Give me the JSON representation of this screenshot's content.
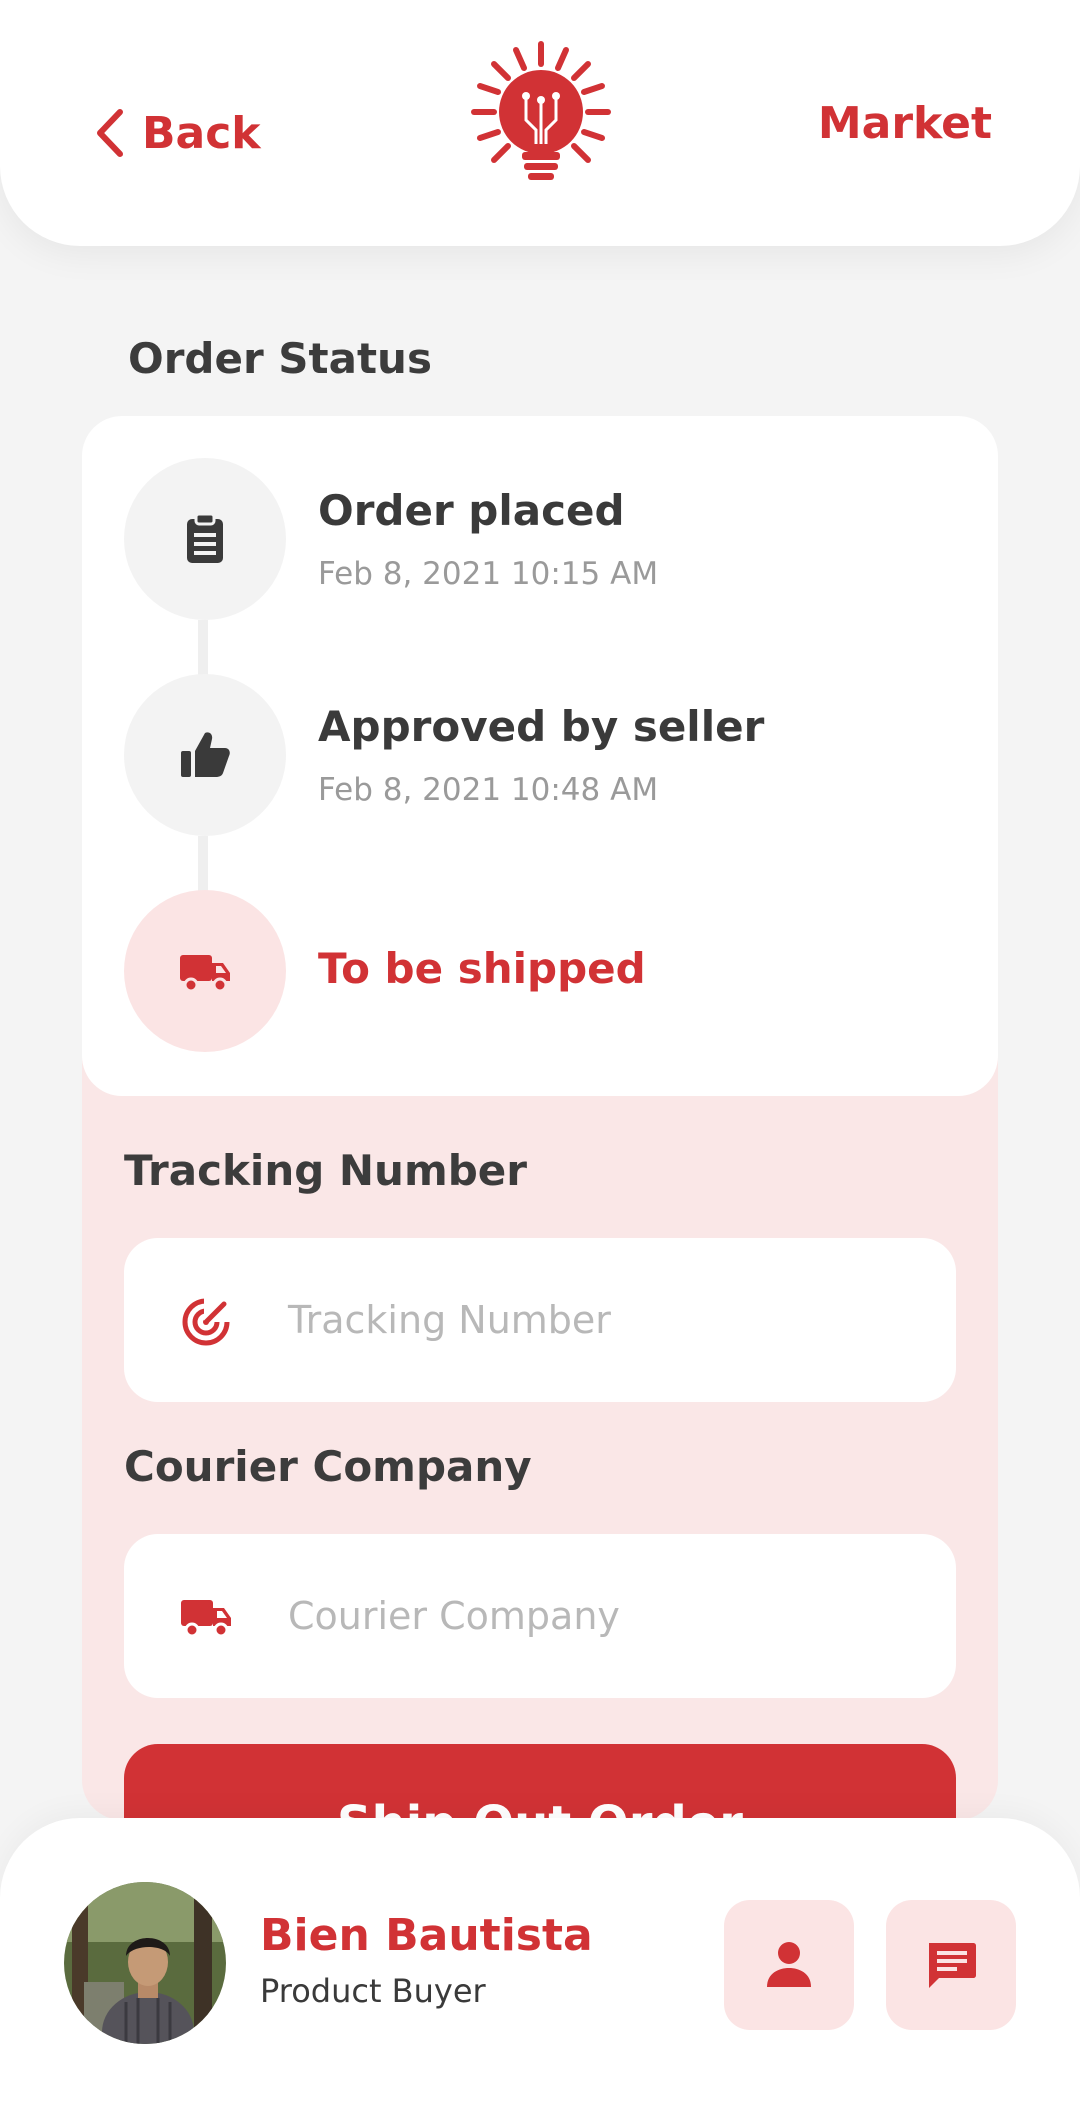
{
  "header": {
    "back_label": "Back",
    "market_label": "Market",
    "logo_icon": "sun-lightbulb-logo"
  },
  "order_status": {
    "title": "Order Status",
    "steps": [
      {
        "title": "Order placed",
        "date": "Feb 8, 2021 10:15 AM",
        "icon": "clipboard-icon",
        "active": false
      },
      {
        "title": "Approved by seller",
        "date": "Feb 8, 2021 10:48 AM",
        "icon": "thumbs-up-icon",
        "active": false
      },
      {
        "title": "To be shipped",
        "date": "",
        "icon": "truck-icon",
        "active": true
      }
    ]
  },
  "tracking": {
    "label": "Tracking Number",
    "placeholder": "Tracking Number",
    "icon": "target-icon"
  },
  "courier": {
    "label": "Courier Company",
    "placeholder": "Courier Company",
    "icon": "truck-icon"
  },
  "ship_button": {
    "label": "Ship Out Order"
  },
  "footer": {
    "user_name": "Bien Bautista",
    "user_role": "Product Buyer",
    "profile_icon": "person-icon",
    "chat_icon": "chat-icon"
  },
  "colors": {
    "accent": "#d13235",
    "accent_light": "#fbe4e4",
    "panel_pink": "#fae7e7",
    "background": "#f4f4f4"
  }
}
